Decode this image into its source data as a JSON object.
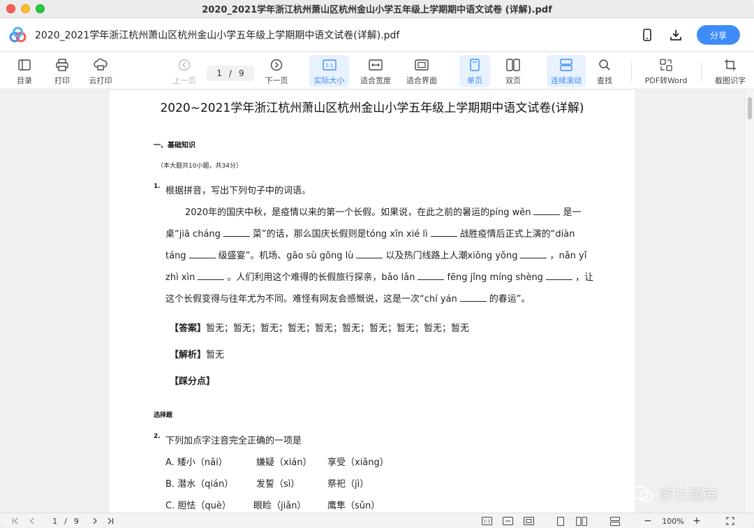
{
  "window": {
    "title": "2020_2021学年浙江杭州萧山区杭州金山小学五年级上学期期中语文试卷 (详解).pdf"
  },
  "header": {
    "file_title": "2020_2021学年浙江杭州萧山区杭州金山小学五年级上学期期中语文试卷(详解).pdf",
    "share_label": "分享"
  },
  "toolbar": {
    "toc": "目录",
    "print": "打印",
    "cloud_print": "云打印",
    "prev": "上一页",
    "current_page": "1",
    "page_sep": "/",
    "total_pages": "9",
    "next": "下一页",
    "actual_size": "实际大小",
    "fit_width": "适合宽度",
    "fit_page": "适合界面",
    "single": "单页",
    "double": "双页",
    "continuous": "连续滚动",
    "find": "查找",
    "pdf2word": "PDF转Word",
    "ocr": "截图识字"
  },
  "document": {
    "title": "2020~2021学年浙江杭州萧山区杭州金山小学五年级上学期期中语文试卷(详解)",
    "section1": "一、基础知识",
    "section1_note": "（本大题共10小题，共34分）",
    "q1_num": "1.",
    "q1_stem": "根据拼音，写出下列句子中的词语。",
    "q1_l1a": "2020年的国庆中秋，是疫情以来的第一个长假。如果说，在此之前的暑运的píng wěn",
    "q1_l1b": "是一",
    "q1_l2a": "桌“jiā cháng",
    "q1_l2b": "菜”的话，那么国庆长假则是tóng xīn xié lì",
    "q1_l2c": "战胜疫情后正式上演的“diàn",
    "q1_l3a": "táng",
    "q1_l3b": "级盛宴”。机场、gāo sù gōng lù",
    "q1_l3c": "以及热门线路上人潮xiōng yǒng",
    "q1_l3d": "，nǎn yǐ",
    "q1_l4a": "zhì xìn",
    "q1_l4b": "。人们利用这个难得的长假旅行探亲，bǎo lǎn",
    "q1_l4c": "fēng jǐng míng shèng",
    "q1_l4d": "，让",
    "q1_l5a": "这个长假变得与往年尤为不同。难怪有网友会感慨说，这是一次“chí yán",
    "q1_l5b": "的春运”。",
    "answer_label": "【答案】",
    "answer_text": "暂无；暂无；暂无；暂无；暂无；暂无；暂无；暂无；暂无；暂无",
    "analysis_label": "【解析】",
    "analysis_text": "暂无",
    "points_label": "【踩分点】",
    "choice_section": "选择题",
    "q2_num": "2.",
    "q2_stem": "下列加点字注音完全正确的一项是",
    "q2_options": [
      {
        "label": "A. 矮小（nǎi）",
        "b": "嫌疑（xián）",
        "c": "享受（xiǎng）"
      },
      {
        "label": "B. 潜水（qián）",
        "b": "发誓（sì）",
        "c": "祭祀（jì）"
      },
      {
        "label": "C. 胆怯（què）",
        "b": "眼睑（jiǎn）",
        "c": "鹰隼（sǔn）"
      }
    ]
  },
  "watermark": {
    "text": "家长题库"
  },
  "statusbar": {
    "current_page": "1",
    "page_sep": "/",
    "total_pages": "9",
    "zoom": "100%"
  },
  "colors": {
    "accent": "#3d8cf8",
    "active_bg": "#e8f1fe"
  }
}
